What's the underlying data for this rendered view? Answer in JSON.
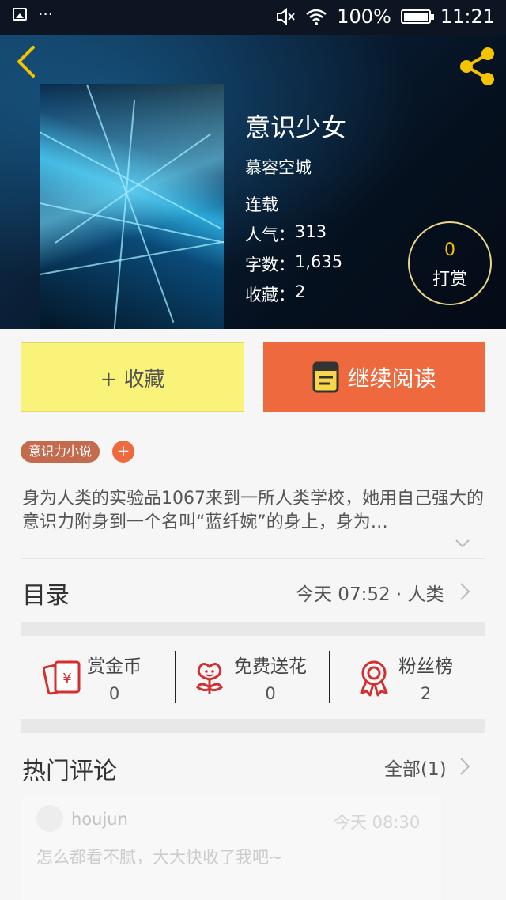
{
  "status_bar": {
    "dots": "···",
    "battery": "100%",
    "time": "11:21"
  },
  "book": {
    "title": "意识少女",
    "author": "慕容空城",
    "status": "连载",
    "stats": [
      {
        "label": "人气：",
        "value": "313"
      },
      {
        "label": "字数：",
        "value": "1,635"
      },
      {
        "label": "收藏：",
        "value": "2"
      }
    ],
    "tip": {
      "count": "0",
      "label": "打赏"
    }
  },
  "actions": {
    "collect": "+ 收藏",
    "read": "继续阅读"
  },
  "tags": [
    "意识力小说"
  ],
  "tag_add": "+",
  "description": "身为人类的实验品1067来到一所人类学校，她用自己强大的意识力附身到一个名叫“蓝纤婉”的身上，身为…",
  "catalog": {
    "title": "目录",
    "info": "今天 07:52 · 人类"
  },
  "rewards": [
    {
      "label": "赏金币",
      "value": "0"
    },
    {
      "label": "免费送花",
      "value": "0"
    },
    {
      "label": "粉丝榜",
      "value": "2"
    }
  ],
  "hot_comments": {
    "title": "热门评论",
    "all": "全部(1)",
    "items": [
      {
        "user": "houjun",
        "time": "今天 08:30",
        "text": "怎么都看不腻，大大快收了我吧~"
      }
    ]
  },
  "colors": {
    "accent": "#ee6a3e",
    "collect_bg": "#faf37a",
    "tag": "#c46b4e",
    "tip_number": "#f5c400"
  }
}
